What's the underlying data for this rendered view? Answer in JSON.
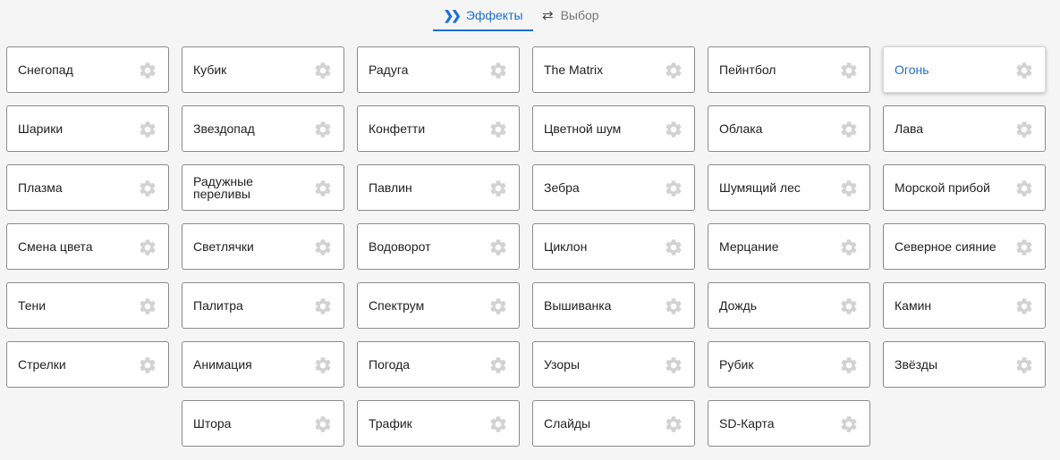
{
  "tabs": {
    "effects_label": "Эффекты",
    "effects_icon": "double-chevron-right-icon",
    "select_label": "Выбор",
    "select_icon": "swap-arrows-icon",
    "active_color": "#1e6fd0"
  },
  "effects": [
    "Снегопад",
    "Кубик",
    "Радуга",
    "The Matrix",
    "Пейнтбол",
    "Огонь",
    "Шарики",
    "Звездопад",
    "Конфетти",
    "Цветной шум",
    "Облака",
    "Лава",
    "Плазма",
    "Радужные переливы",
    "Павлин",
    "Зебра",
    "Шумящий лес",
    "Морской прибой",
    "Смена цвета",
    "Светлячки",
    "Водоворот",
    "Циклон",
    "Мерцание",
    "Северное сияние",
    "Тени",
    "Палитра",
    "Спектрум",
    "Вышиванка",
    "Дождь",
    "Камин",
    "Стрелки",
    "Анимация",
    "Погода",
    "Узоры",
    "Рубик",
    "Звёзды",
    "Штора",
    "Трафик",
    "Слайды",
    "SD-Карта"
  ],
  "active_effect": "Огонь"
}
